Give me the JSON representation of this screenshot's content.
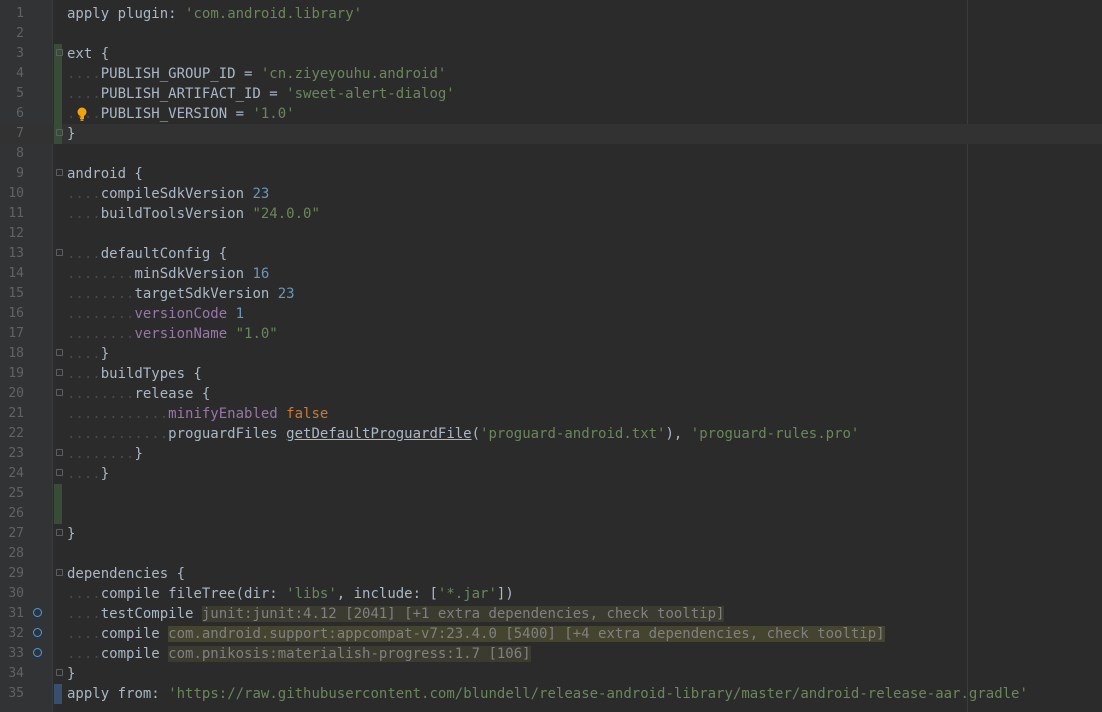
{
  "editor": {
    "lines": [
      {
        "n": "1",
        "segments": [
          {
            "t": "apply",
            "c": ""
          },
          {
            "t": " ",
            "c": "dots"
          },
          {
            "t": "plugin:",
            "c": "named"
          },
          {
            "t": " ",
            "c": "dots"
          },
          {
            "t": "'com.android.library'",
            "c": "str"
          }
        ]
      },
      {
        "n": "2",
        "segments": []
      },
      {
        "n": "3",
        "segments": [
          {
            "t": "ext {",
            "c": ""
          }
        ]
      },
      {
        "n": "4",
        "segments": [
          {
            "t": "....",
            "c": "dots"
          },
          {
            "t": "PUBLISH_GROUP_ID = ",
            "c": ""
          },
          {
            "t": "'cn.ziyeyouhu.android'",
            "c": "str"
          }
        ]
      },
      {
        "n": "5",
        "segments": [
          {
            "t": "....",
            "c": "dots"
          },
          {
            "t": "PUBLISH_ARTIFACT_ID = ",
            "c": ""
          },
          {
            "t": "'sweet-alert-dialog'",
            "c": "str"
          }
        ]
      },
      {
        "n": "6",
        "segments": [
          {
            "t": "....",
            "c": "dots"
          },
          {
            "t": "PUBLISH_VERSION = ",
            "c": ""
          },
          {
            "t": "'1.0'",
            "c": "str"
          }
        ]
      },
      {
        "n": "7",
        "segments": [
          {
            "t": "}",
            "c": ""
          }
        ]
      },
      {
        "n": "8",
        "segments": []
      },
      {
        "n": "9",
        "segments": [
          {
            "t": "android {",
            "c": ""
          }
        ]
      },
      {
        "n": "10",
        "segments": [
          {
            "t": "....",
            "c": "dots"
          },
          {
            "t": "compileSdkVersion ",
            "c": ""
          },
          {
            "t": "23",
            "c": "num"
          }
        ]
      },
      {
        "n": "11",
        "segments": [
          {
            "t": "....",
            "c": "dots"
          },
          {
            "t": "buildToolsVersion ",
            "c": ""
          },
          {
            "t": "\"24.0.0\"",
            "c": "str"
          }
        ]
      },
      {
        "n": "12",
        "segments": []
      },
      {
        "n": "13",
        "segments": [
          {
            "t": "....",
            "c": "dots"
          },
          {
            "t": "defaultConfig {",
            "c": ""
          }
        ]
      },
      {
        "n": "14",
        "segments": [
          {
            "t": "........",
            "c": "dots"
          },
          {
            "t": "minSdkVersion ",
            "c": ""
          },
          {
            "t": "16",
            "c": "num"
          }
        ]
      },
      {
        "n": "15",
        "segments": [
          {
            "t": "........",
            "c": "dots"
          },
          {
            "t": "targetSdkVersion ",
            "c": ""
          },
          {
            "t": "23",
            "c": "num"
          }
        ]
      },
      {
        "n": "16",
        "segments": [
          {
            "t": "........",
            "c": "dots"
          },
          {
            "t": "versionCode ",
            "c": "purple"
          },
          {
            "t": "1",
            "c": "num"
          }
        ]
      },
      {
        "n": "17",
        "segments": [
          {
            "t": "........",
            "c": "dots"
          },
          {
            "t": "versionName ",
            "c": "purple"
          },
          {
            "t": "\"1.0\"",
            "c": "str"
          }
        ]
      },
      {
        "n": "18",
        "segments": [
          {
            "t": "....",
            "c": "dots"
          },
          {
            "t": "}",
            "c": ""
          }
        ]
      },
      {
        "n": "19",
        "segments": [
          {
            "t": "....",
            "c": "dots"
          },
          {
            "t": "buildTypes {",
            "c": ""
          }
        ]
      },
      {
        "n": "20",
        "segments": [
          {
            "t": "........",
            "c": "dots"
          },
          {
            "t": "release {",
            "c": ""
          }
        ]
      },
      {
        "n": "21",
        "segments": [
          {
            "t": "............",
            "c": "dots"
          },
          {
            "t": "minifyEnabled ",
            "c": "purple"
          },
          {
            "t": "false",
            "c": "kw"
          }
        ]
      },
      {
        "n": "22",
        "segments": [
          {
            "t": "............",
            "c": "dots"
          },
          {
            "t": "proguardFiles ",
            "c": ""
          },
          {
            "t": "getDefaultProguardFile",
            "c": "method"
          },
          {
            "t": "(",
            "c": ""
          },
          {
            "t": "'proguard-android.txt'",
            "c": "str"
          },
          {
            "t": "), ",
            "c": ""
          },
          {
            "t": "'proguard-rules.pro'",
            "c": "str"
          }
        ]
      },
      {
        "n": "23",
        "segments": [
          {
            "t": "........",
            "c": "dots"
          },
          {
            "t": "}",
            "c": ""
          }
        ]
      },
      {
        "n": "24",
        "segments": [
          {
            "t": "....",
            "c": "dots"
          },
          {
            "t": "}",
            "c": ""
          }
        ]
      },
      {
        "n": "25",
        "segments": []
      },
      {
        "n": "26",
        "segments": []
      },
      {
        "n": "27",
        "segments": [
          {
            "t": "}",
            "c": ""
          }
        ]
      },
      {
        "n": "28",
        "segments": []
      },
      {
        "n": "29",
        "segments": [
          {
            "t": "dependencies {",
            "c": ""
          }
        ]
      },
      {
        "n": "30",
        "segments": [
          {
            "t": "....",
            "c": "dots"
          },
          {
            "t": "compile ",
            "c": ""
          },
          {
            "t": "fileTree(",
            "c": ""
          },
          {
            "t": "dir:",
            "c": "named"
          },
          {
            "t": " ",
            "c": "dots"
          },
          {
            "t": "'libs'",
            "c": "str"
          },
          {
            "t": ", ",
            "c": ""
          },
          {
            "t": "include:",
            "c": "named"
          },
          {
            "t": " [",
            "c": ""
          },
          {
            "t": "'*.jar'",
            "c": "str"
          },
          {
            "t": "])",
            "c": ""
          }
        ]
      },
      {
        "n": "31",
        "segments": [
          {
            "t": "....",
            "c": "dots"
          },
          {
            "t": "testCompile ",
            "c": ""
          },
          {
            "t": "junit:junit:4.12 [2041] [+1 extra dependencies, check tooltip]",
            "c": "hl"
          }
        ]
      },
      {
        "n": "32",
        "segments": [
          {
            "t": "....",
            "c": "dots"
          },
          {
            "t": "compile ",
            "c": ""
          },
          {
            "t": "com.android.support:appcompat-v7:23.4.0 [5400] [+4 extra dependencies, check tooltip]",
            "c": "hl-strong"
          }
        ]
      },
      {
        "n": "33",
        "segments": [
          {
            "t": "....",
            "c": "dots"
          },
          {
            "t": "compile ",
            "c": ""
          },
          {
            "t": "com.pnikosis:materialish-progress:1.7 [106]",
            "c": "hl"
          }
        ]
      },
      {
        "n": "34",
        "segments": [
          {
            "t": "}",
            "c": ""
          }
        ]
      },
      {
        "n": "35",
        "segments": [
          {
            "t": "apply",
            "c": ""
          },
          {
            "t": " ",
            "c": "dots"
          },
          {
            "t": "from:",
            "c": "named"
          },
          {
            "t": " ",
            "c": "dots"
          },
          {
            "t": "'https://raw.githubusercontent.com/blundell/release-android-library/master/android-release-aar.gradle'",
            "c": "str"
          }
        ]
      }
    ]
  },
  "colors": {
    "background": "#2b2b2b",
    "gutter": "#313335",
    "string": "#6a8759",
    "keyword": "#cc7832",
    "number": "#6897bb",
    "property": "#9876aa",
    "marker": "#4a9be8"
  },
  "icons": {
    "line6": "lightbulb-icon",
    "line31": "dependency-marker-icon",
    "line32": "dependency-marker-icon",
    "line33": "dependency-marker-icon"
  }
}
